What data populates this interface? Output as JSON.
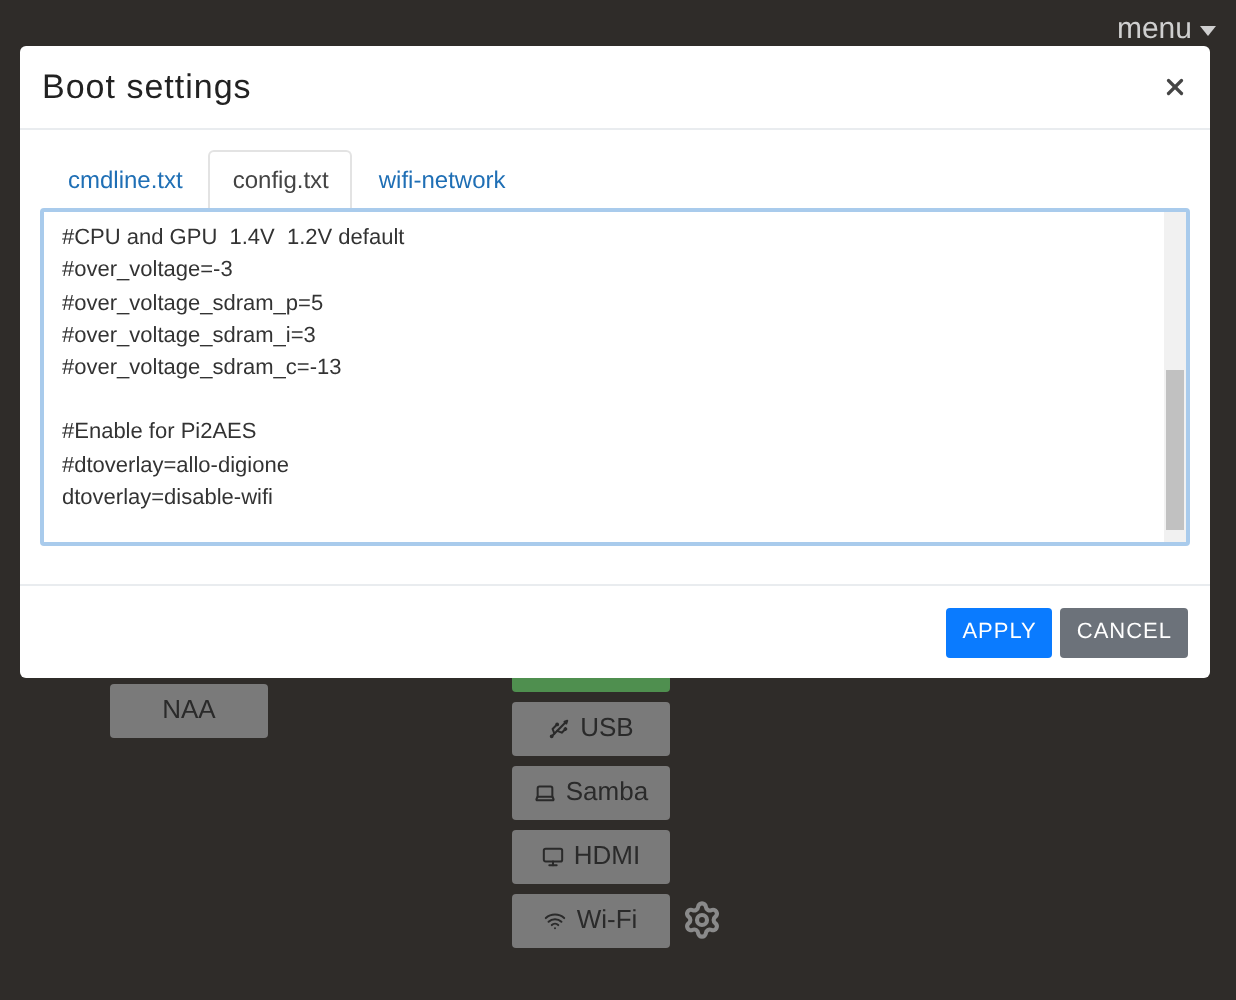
{
  "menu": {
    "label": "menu"
  },
  "dialog": {
    "title": "Boot settings",
    "tabs": [
      {
        "label": "cmdline.txt",
        "selected": false
      },
      {
        "label": "config.txt",
        "selected": true
      },
      {
        "label": "wifi-network",
        "selected": false
      }
    ],
    "editor": {
      "blocks": [
        [
          "#CPU and GPU  1.4V  1.2V default",
          "#over_voltage=-3",
          "#over_voltage_sdram_p=5",
          "#over_voltage_sdram_i=3",
          "#over_voltage_sdram_c=-13"
        ],
        [
          "#Enable for Pi2AES",
          "#dtoverlay=allo-digione",
          "dtoverlay=disable-wifi"
        ]
      ]
    },
    "buttons": [
      {
        "label": "APPLY",
        "kind": "primary"
      },
      {
        "label": "CANCEL",
        "kind": "secondary"
      }
    ]
  },
  "left_buttons": [
    {
      "label": "NAA"
    }
  ],
  "sources": [
    {
      "label": "USB",
      "kind": "usb"
    },
    {
      "label": "Samba",
      "kind": "laptop"
    },
    {
      "label": "HDMI",
      "kind": "monitor"
    },
    {
      "label": "Wi-Fi",
      "kind": "wifi",
      "settings": true
    }
  ]
}
